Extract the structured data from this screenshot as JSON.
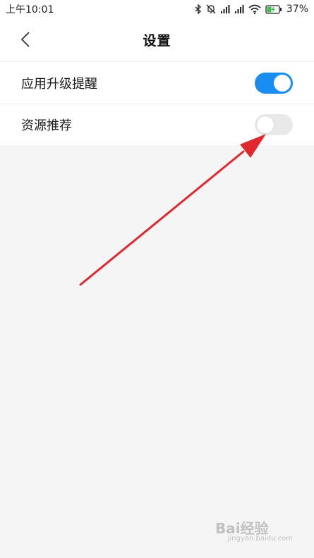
{
  "status_bar": {
    "time": "上午10:01",
    "battery": "37%",
    "icons": [
      "bluetooth-icon",
      "mute-bell-icon",
      "signal-icon",
      "signal-icon",
      "wifi-icon",
      "battery-charging-icon"
    ]
  },
  "header": {
    "title": "设置",
    "back_icon": "chevron-left-icon"
  },
  "settings": [
    {
      "label": "应用升级提醒",
      "enabled": true
    },
    {
      "label": "资源推荐",
      "enabled": false
    }
  ],
  "colors": {
    "toggle_on": "#1a8df0",
    "toggle_off": "#e9e9e9",
    "annotation_arrow": "#e0282e"
  },
  "watermark": {
    "text": "Bai经验",
    "sub": "jingyan.baidu.com"
  }
}
